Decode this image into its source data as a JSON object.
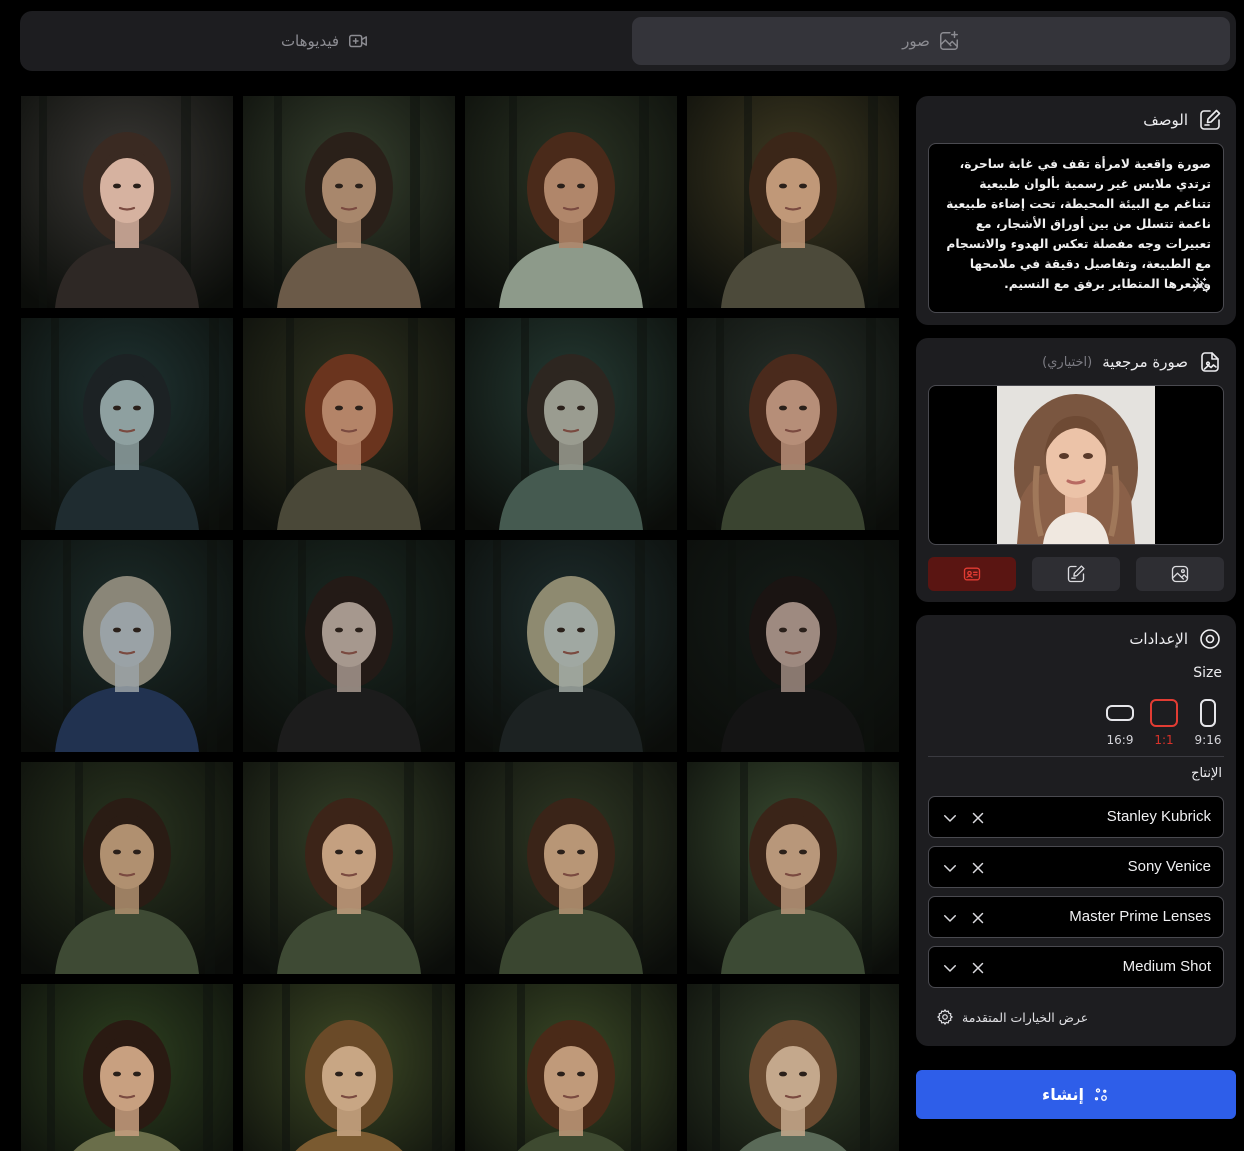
{
  "tabs": {
    "videos": {
      "label": "فيديوهات",
      "icon": "video-plus-icon"
    },
    "images": {
      "label": "صور",
      "icon": "image-plus-icon",
      "selected": true
    }
  },
  "gallery": {
    "thumbnails": [
      {
        "id": "t1",
        "bg": "#3b3936",
        "skin": "#d6b2a0",
        "hair": "#3a2a22",
        "cloth": "#2e2825"
      },
      {
        "id": "t2",
        "bg": "#36402e",
        "skin": "#a8876c",
        "hair": "#2a2019",
        "cloth": "#6b5a48"
      },
      {
        "id": "t3",
        "bg": "#2b3424",
        "skin": "#b0866a",
        "hair": "#4a2a1a",
        "cloth": "#8d9a8a"
      },
      {
        "id": "t4",
        "bg": "#3f3a22",
        "skin": "#c09878",
        "hair": "#3b2618",
        "cloth": "#4c4a3a"
      },
      {
        "id": "t5",
        "bg": "#1f3332",
        "skin": "#8ea0a0",
        "hair": "#1c2224",
        "cloth": "#1f2c30"
      },
      {
        "id": "t6",
        "bg": "#2f3320",
        "skin": "#b48468",
        "hair": "#6a341e",
        "cloth": "#4a4838"
      },
      {
        "id": "t7",
        "bg": "#253a33",
        "skin": "#9a9c90",
        "hair": "#2d2620",
        "cloth": "#455a50"
      },
      {
        "id": "t8",
        "bg": "#27302a",
        "skin": "#b68e78",
        "hair": "#4a2a1c",
        "cloth": "#3a4430"
      },
      {
        "id": "t9",
        "bg": "#1c2c2a",
        "skin": "#9aa2a6",
        "hair": "#8a8678",
        "cloth": "#213250"
      },
      {
        "id": "t10",
        "bg": "#1a2822",
        "skin": "#a6988e",
        "hair": "#231a16",
        "cloth": "#1c1c1c"
      },
      {
        "id": "t11",
        "bg": "#1d2c2c",
        "skin": "#a0a8a2",
        "hair": "#8e8a70",
        "cloth": "#1c2222"
      },
      {
        "id": "t12",
        "bg": "#141c18",
        "skin": "#9e8a80",
        "hair": "#1a1412",
        "cloth": "#141414"
      },
      {
        "id": "t13",
        "bg": "#2a3520",
        "skin": "#b09070",
        "hair": "#2a1c14",
        "cloth": "#3e4a34"
      },
      {
        "id": "t14",
        "bg": "#354028",
        "skin": "#c4a080",
        "hair": "#3c2418",
        "cloth": "#3e4a34"
      },
      {
        "id": "t15",
        "bg": "#2f3824",
        "skin": "#b89676",
        "hair": "#3a2418",
        "cloth": "#3a4630"
      },
      {
        "id": "t16",
        "bg": "#394a30",
        "skin": "#b8977a",
        "hair": "#3a2418",
        "cloth": "#3c4a34"
      },
      {
        "id": "t17",
        "bg": "#2e4020",
        "skin": "#c8a080",
        "hair": "#2a1a12",
        "cloth": "#6a6e4a"
      },
      {
        "id": "t18",
        "bg": "#3e4a26",
        "skin": "#c8a684",
        "hair": "#6a4a28",
        "cloth": "#7a5a30"
      },
      {
        "id": "t19",
        "bg": "#3a4826",
        "skin": "#c09a7a",
        "hair": "#4a2a18",
        "cloth": "#3e4a30"
      },
      {
        "id": "t20",
        "bg": "#33402a",
        "skin": "#c4a88c",
        "hair": "#6a4a30",
        "cloth": "#5a6a58"
      }
    ]
  },
  "description": {
    "title": "الوصف",
    "icon": "edit-icon",
    "text": "صورة واقعية لامرأة تقف في غابة ساحرة، ترتدي ملابس غير رسمية بألوان طبيعية تتناغم مع البيئة المحيطة، تحت إضاءة طبيعية ناعمة تتسلل من بين أوراق الأشجار، مع تعبيرات وجه مفصلة تعكس الهدوء والانسجام مع الطبيعة، وتفاصيل دقيقة في ملامحها وشعرها المتطاير برفق مع النسيم.",
    "enhance_icon": "magic-wand-icon"
  },
  "reference": {
    "title": "صورة مرجعية",
    "optional": "(اختياري)",
    "icon": "image-upload-icon",
    "modes": [
      "image-icon",
      "edit-icon",
      "id-card-icon"
    ],
    "active_mode": "id-card-icon"
  },
  "settings": {
    "title": "الإعدادات",
    "icon": "settings-circle-icon",
    "size_label": "Size",
    "ratios": [
      {
        "label": "9:16",
        "active": false
      },
      {
        "label": "1:1",
        "active": true
      },
      {
        "label": "16:9",
        "active": false
      }
    ],
    "production_label": "الإنتاج",
    "selects": [
      {
        "value": "Stanley Kubrick"
      },
      {
        "value": "Sony Venice"
      },
      {
        "value": "Master Prime Lenses"
      },
      {
        "value": "Medium Shot"
      }
    ],
    "advanced_label": "عرض الخيارات المتقدمة"
  },
  "create": {
    "label": "إنشاء",
    "icon": "sparkle-icon",
    "color": "#2e5ee9"
  },
  "colors": {
    "accent_red": "#e23c33",
    "panel": "#1d1d20"
  }
}
